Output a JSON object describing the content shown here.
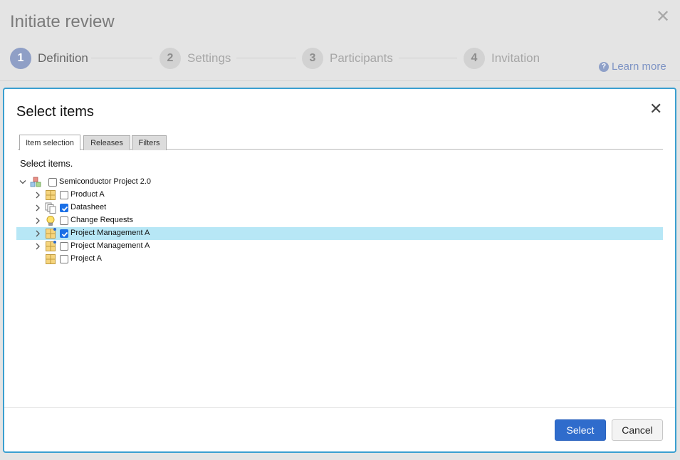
{
  "wizard": {
    "title": "Initiate review",
    "close_glyph": "✕",
    "steps": [
      {
        "number": "1",
        "label": "Definition",
        "active": true
      },
      {
        "number": "2",
        "label": "Settings",
        "active": false
      },
      {
        "number": "3",
        "label": "Participants",
        "active": false
      },
      {
        "number": "4",
        "label": "Invitation",
        "active": false
      }
    ],
    "learn_more": "Learn more",
    "help_glyph": "?"
  },
  "dialog": {
    "title": "Select items",
    "close_glyph": "✕",
    "tabs": [
      {
        "label": "Item selection",
        "active": true
      },
      {
        "label": "Releases",
        "active": false
      },
      {
        "label": "Filters",
        "active": false
      }
    ],
    "instructions": "Select items.",
    "tree": [
      {
        "label": "Semiconductor Project 2.0",
        "icon": "project-icon",
        "checked": false,
        "expanded": true,
        "level": 0
      },
      {
        "label": "Product A",
        "icon": "tracker-icon",
        "checked": false,
        "expanded": false,
        "level": 1
      },
      {
        "label": "Datasheet",
        "icon": "documents-icon",
        "checked": true,
        "expanded": false,
        "level": 1
      },
      {
        "label": "Change Requests",
        "icon": "lightbulb-icon",
        "checked": false,
        "expanded": false,
        "level": 1
      },
      {
        "label": "Project Management A",
        "icon": "tracker-icon",
        "checked": true,
        "expanded": false,
        "level": 1,
        "selected": true
      },
      {
        "label": "Project Management A",
        "icon": "tracker-icon",
        "checked": false,
        "expanded": false,
        "level": 1
      },
      {
        "label": "Project A",
        "icon": "tracker-icon",
        "checked": false,
        "expanded": null,
        "level": 1
      }
    ],
    "buttons": {
      "select": "Select",
      "cancel": "Cancel"
    }
  },
  "colors": {
    "accent": "#2f6ccc",
    "dialog_border": "#3a9fd0",
    "row_highlight": "#b7e7f6",
    "checkbox_checked": "#1a6fe6"
  }
}
